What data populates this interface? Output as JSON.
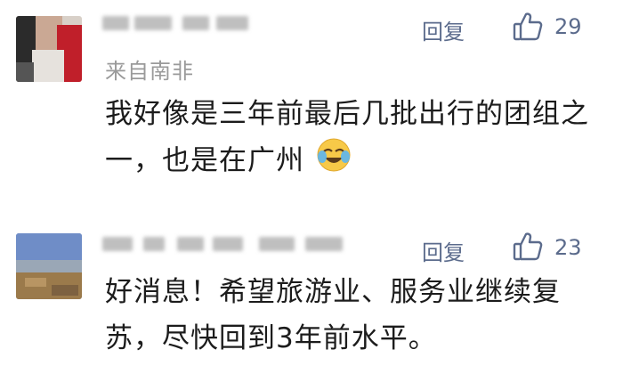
{
  "comments": [
    {
      "region": "来自南非",
      "reply_label": "回复",
      "likes": "29",
      "text": "我好像是三年前最后几批出行的团组之一，也是在广州",
      "emoji": "crying-laughing-emoji"
    },
    {
      "reply_label": "回复",
      "likes": "23",
      "text": "好消息！希望旅游业、服务业继续复苏，尽快回到3年前水平。"
    }
  ],
  "colors": {
    "action": "#5b6b8c",
    "secondary": "#9a9a9a",
    "body": "#1c1c1c"
  }
}
